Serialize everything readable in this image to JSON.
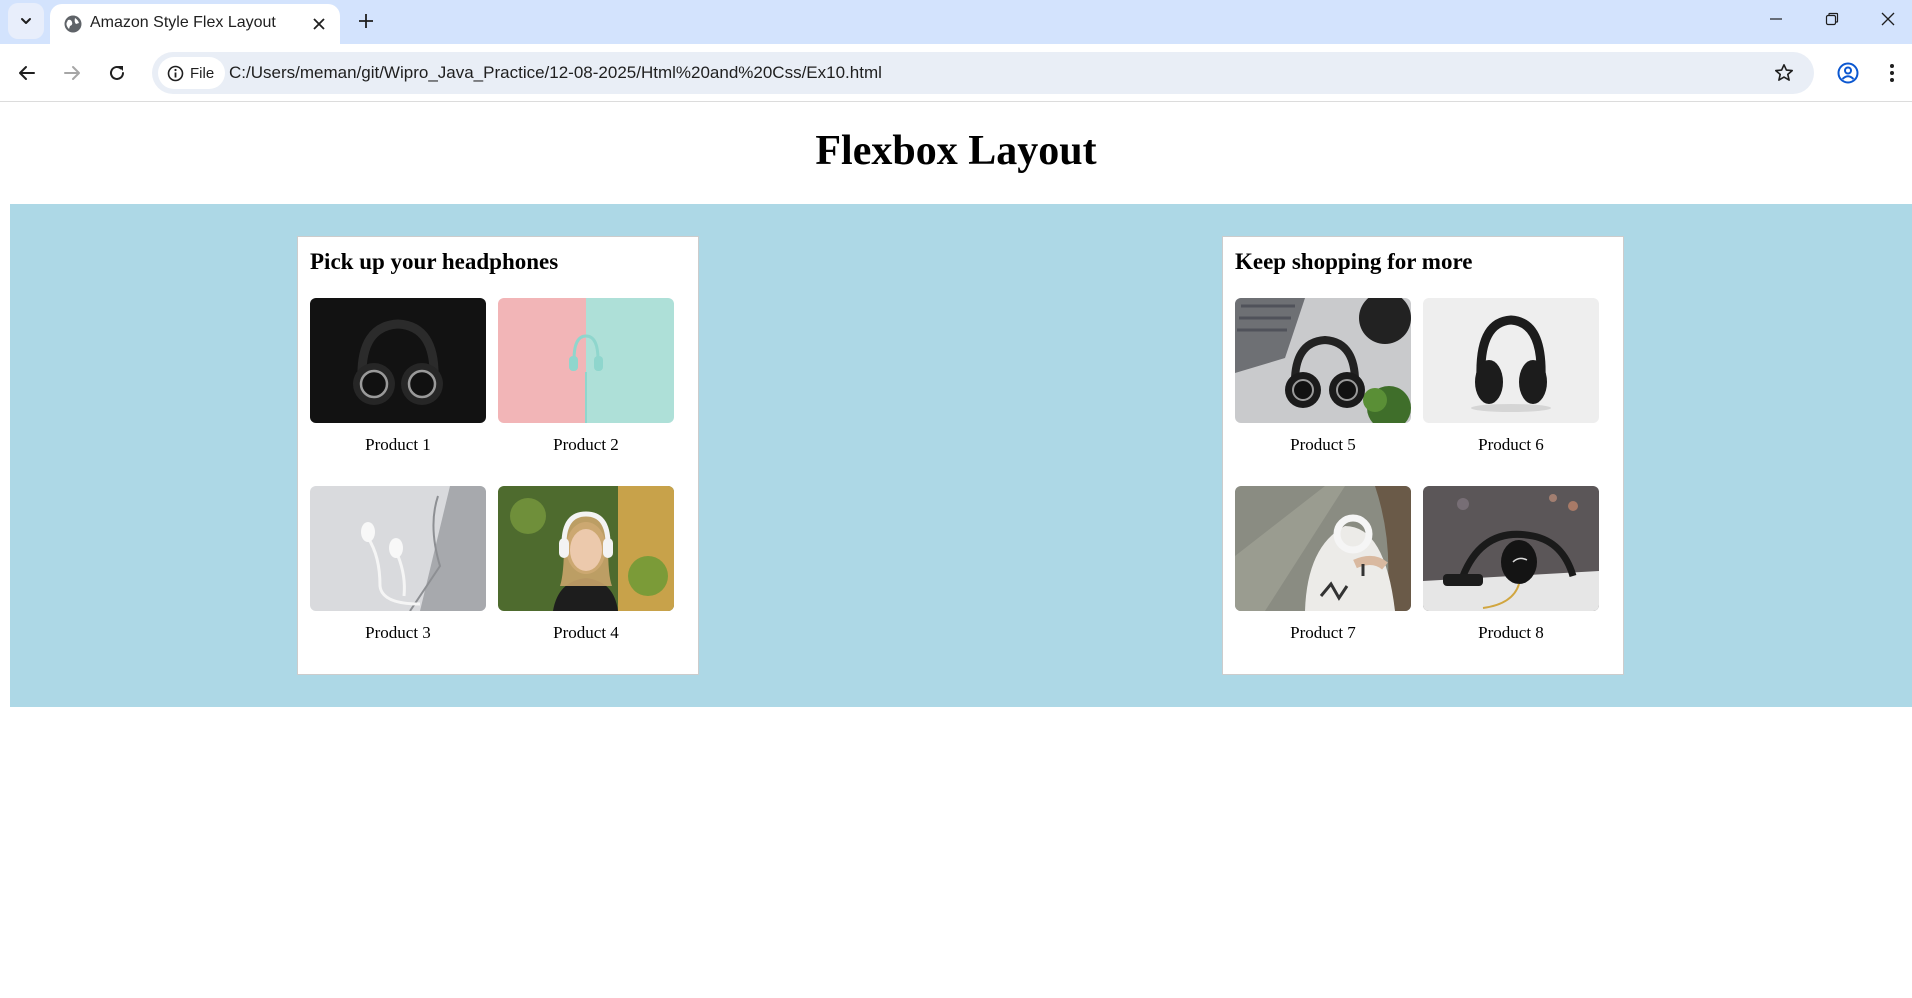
{
  "browser": {
    "tab_title": "Amazon Style Flex Layout",
    "site_chip_label": "File",
    "url": "C:/Users/meman/git/Wipro_Java_Practice/12-08-2025/Html%20and%20Css/Ex10.html"
  },
  "icons": {
    "tab_search": "chevron-down-icon",
    "favicon": "globe-icon",
    "close_tab": "close-icon",
    "new_tab": "plus-icon",
    "back": "arrow-left-icon",
    "forward": "arrow-right-icon",
    "reload": "reload-icon",
    "site_info": "info-icon",
    "bookmark": "star-icon",
    "profile": "account-icon",
    "menu": "kebab-menu-icon"
  },
  "colors": {
    "tabstrip": "#d3e3fd",
    "omnibox": "#e9eef6",
    "band": "#add8e6",
    "card": "#ffffff"
  },
  "page": {
    "heading": "Flexbox Layout",
    "cards": [
      {
        "title": "Pick up your headphones",
        "products": [
          {
            "label": "Product 1"
          },
          {
            "label": "Product 2"
          },
          {
            "label": "Product 3"
          },
          {
            "label": "Product 4"
          }
        ]
      },
      {
        "title": "Keep shopping for more",
        "products": [
          {
            "label": "Product 5"
          },
          {
            "label": "Product 6"
          },
          {
            "label": "Product 7"
          },
          {
            "label": "Product 8"
          }
        ]
      }
    ]
  }
}
